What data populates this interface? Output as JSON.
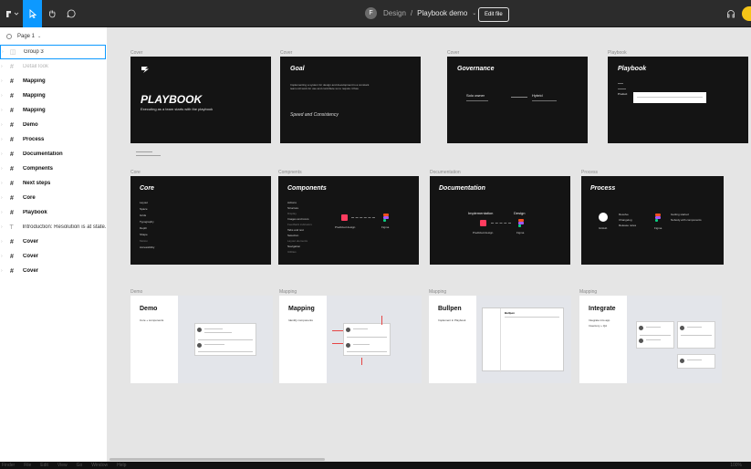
{
  "toolbar": {
    "user_initial": "F",
    "breadcrumb_project": "Design",
    "breadcrumb_separator": "/",
    "file_name": "Playbook demo",
    "edit_file": "Edit file"
  },
  "sidebar": {
    "page": "Page 1",
    "layers": [
      {
        "icon": "◫",
        "label": "Group 3",
        "state": "selected"
      },
      {
        "icon": "#",
        "label": "Detail look",
        "state": "dim"
      },
      {
        "icon": "#",
        "label": "Mapping",
        "state": "normal"
      },
      {
        "icon": "#",
        "label": "Mapping",
        "state": "normal"
      },
      {
        "icon": "#",
        "label": "Mapping",
        "state": "normal"
      },
      {
        "icon": "#",
        "label": "Demo",
        "state": "normal"
      },
      {
        "icon": "#",
        "label": "Process",
        "state": "normal"
      },
      {
        "icon": "#",
        "label": "Documentation",
        "state": "normal"
      },
      {
        "icon": "#",
        "label": "Compnents",
        "state": "normal"
      },
      {
        "icon": "#",
        "label": "Next steps",
        "state": "normal"
      },
      {
        "icon": "#",
        "label": "Core",
        "state": "normal"
      },
      {
        "icon": "#",
        "label": "Playbook",
        "state": "normal"
      },
      {
        "icon": "T",
        "label": "Introduction: Resolution is at state...",
        "state": "text"
      },
      {
        "icon": "#",
        "label": "Cover",
        "state": "normal"
      },
      {
        "icon": "#",
        "label": "Cover",
        "state": "normal"
      },
      {
        "icon": "#",
        "label": "Cover",
        "state": "normal"
      }
    ]
  },
  "canvas": {
    "row1": {
      "cover1": {
        "label": "Cover",
        "title": "PLAYBOOK",
        "subtitle": "Executing as a team starts with the playbook"
      },
      "cover2": {
        "label": "Cover",
        "title": "Goal",
        "body": "Implementing a system for design and development is a constant team-roll work for use and contribute so to require it flow.",
        "footer": "Speed and Consistency"
      },
      "cover3": {
        "label": "Cover",
        "title": "Governance",
        "left": "Solo owner",
        "right": "Hybrid"
      },
      "playbook": {
        "label": "Playbook",
        "title": "Playbook",
        "product": "Product"
      }
    },
    "row2": {
      "core": {
        "label": "Core",
        "title": "Core",
        "items": [
          "Layout",
          "Space",
          "Grids",
          "Typography",
          "Depth",
          "Shape",
          "Motion",
          "Accessibility"
        ]
      },
      "components": {
        "label": "Compnents",
        "title": "Components",
        "items": [
          "Actions",
          "Structure",
          "Display",
          "Images and icons",
          "Feedback indicators",
          "Tabs and text",
          "Selection",
          "Layout elements",
          "Navigation",
          "Utilities"
        ],
        "caption": "Predicted design",
        "figma": "Figma"
      },
      "documentation": {
        "label": "Documentation",
        "title": "Documentation",
        "left": "Implementation",
        "right": "Design",
        "cap_left": "Predicted design",
        "cap_right": "Figma"
      },
      "process": {
        "label": "Process",
        "title": "Process",
        "items": [
          "Resolve",
          "Changelog",
          "Release notes"
        ],
        "right_items": [
          "Getting started",
          "Nobody with components"
        ],
        "cap_left": "GitHub",
        "cap_right": "Figma"
      }
    },
    "row3": {
      "demo": {
        "label": "Demo",
        "title": "Demo",
        "sub": "Core + components"
      },
      "mapping1": {
        "label": "Mapping",
        "title": "Mapping",
        "sub": "Identify components"
      },
      "mapping2": {
        "label": "Mapping",
        "title": "Bullpen",
        "sub": "Implement in Playbook",
        "panel_title": "Bullpen"
      },
      "mapping3": {
        "label": "Mapping",
        "title": "Integrate",
        "sub": "Integrate into app",
        "sub2": "Inventory + QA"
      }
    }
  },
  "menubar": {
    "items": [
      "Finder",
      "File",
      "Edit",
      "View",
      "Go",
      "Window",
      "Help"
    ],
    "right": "100%"
  },
  "colors": {
    "accent": "#0d99ff",
    "toolbar": "#2c2c2c",
    "canvas": "#e5e5e5"
  }
}
